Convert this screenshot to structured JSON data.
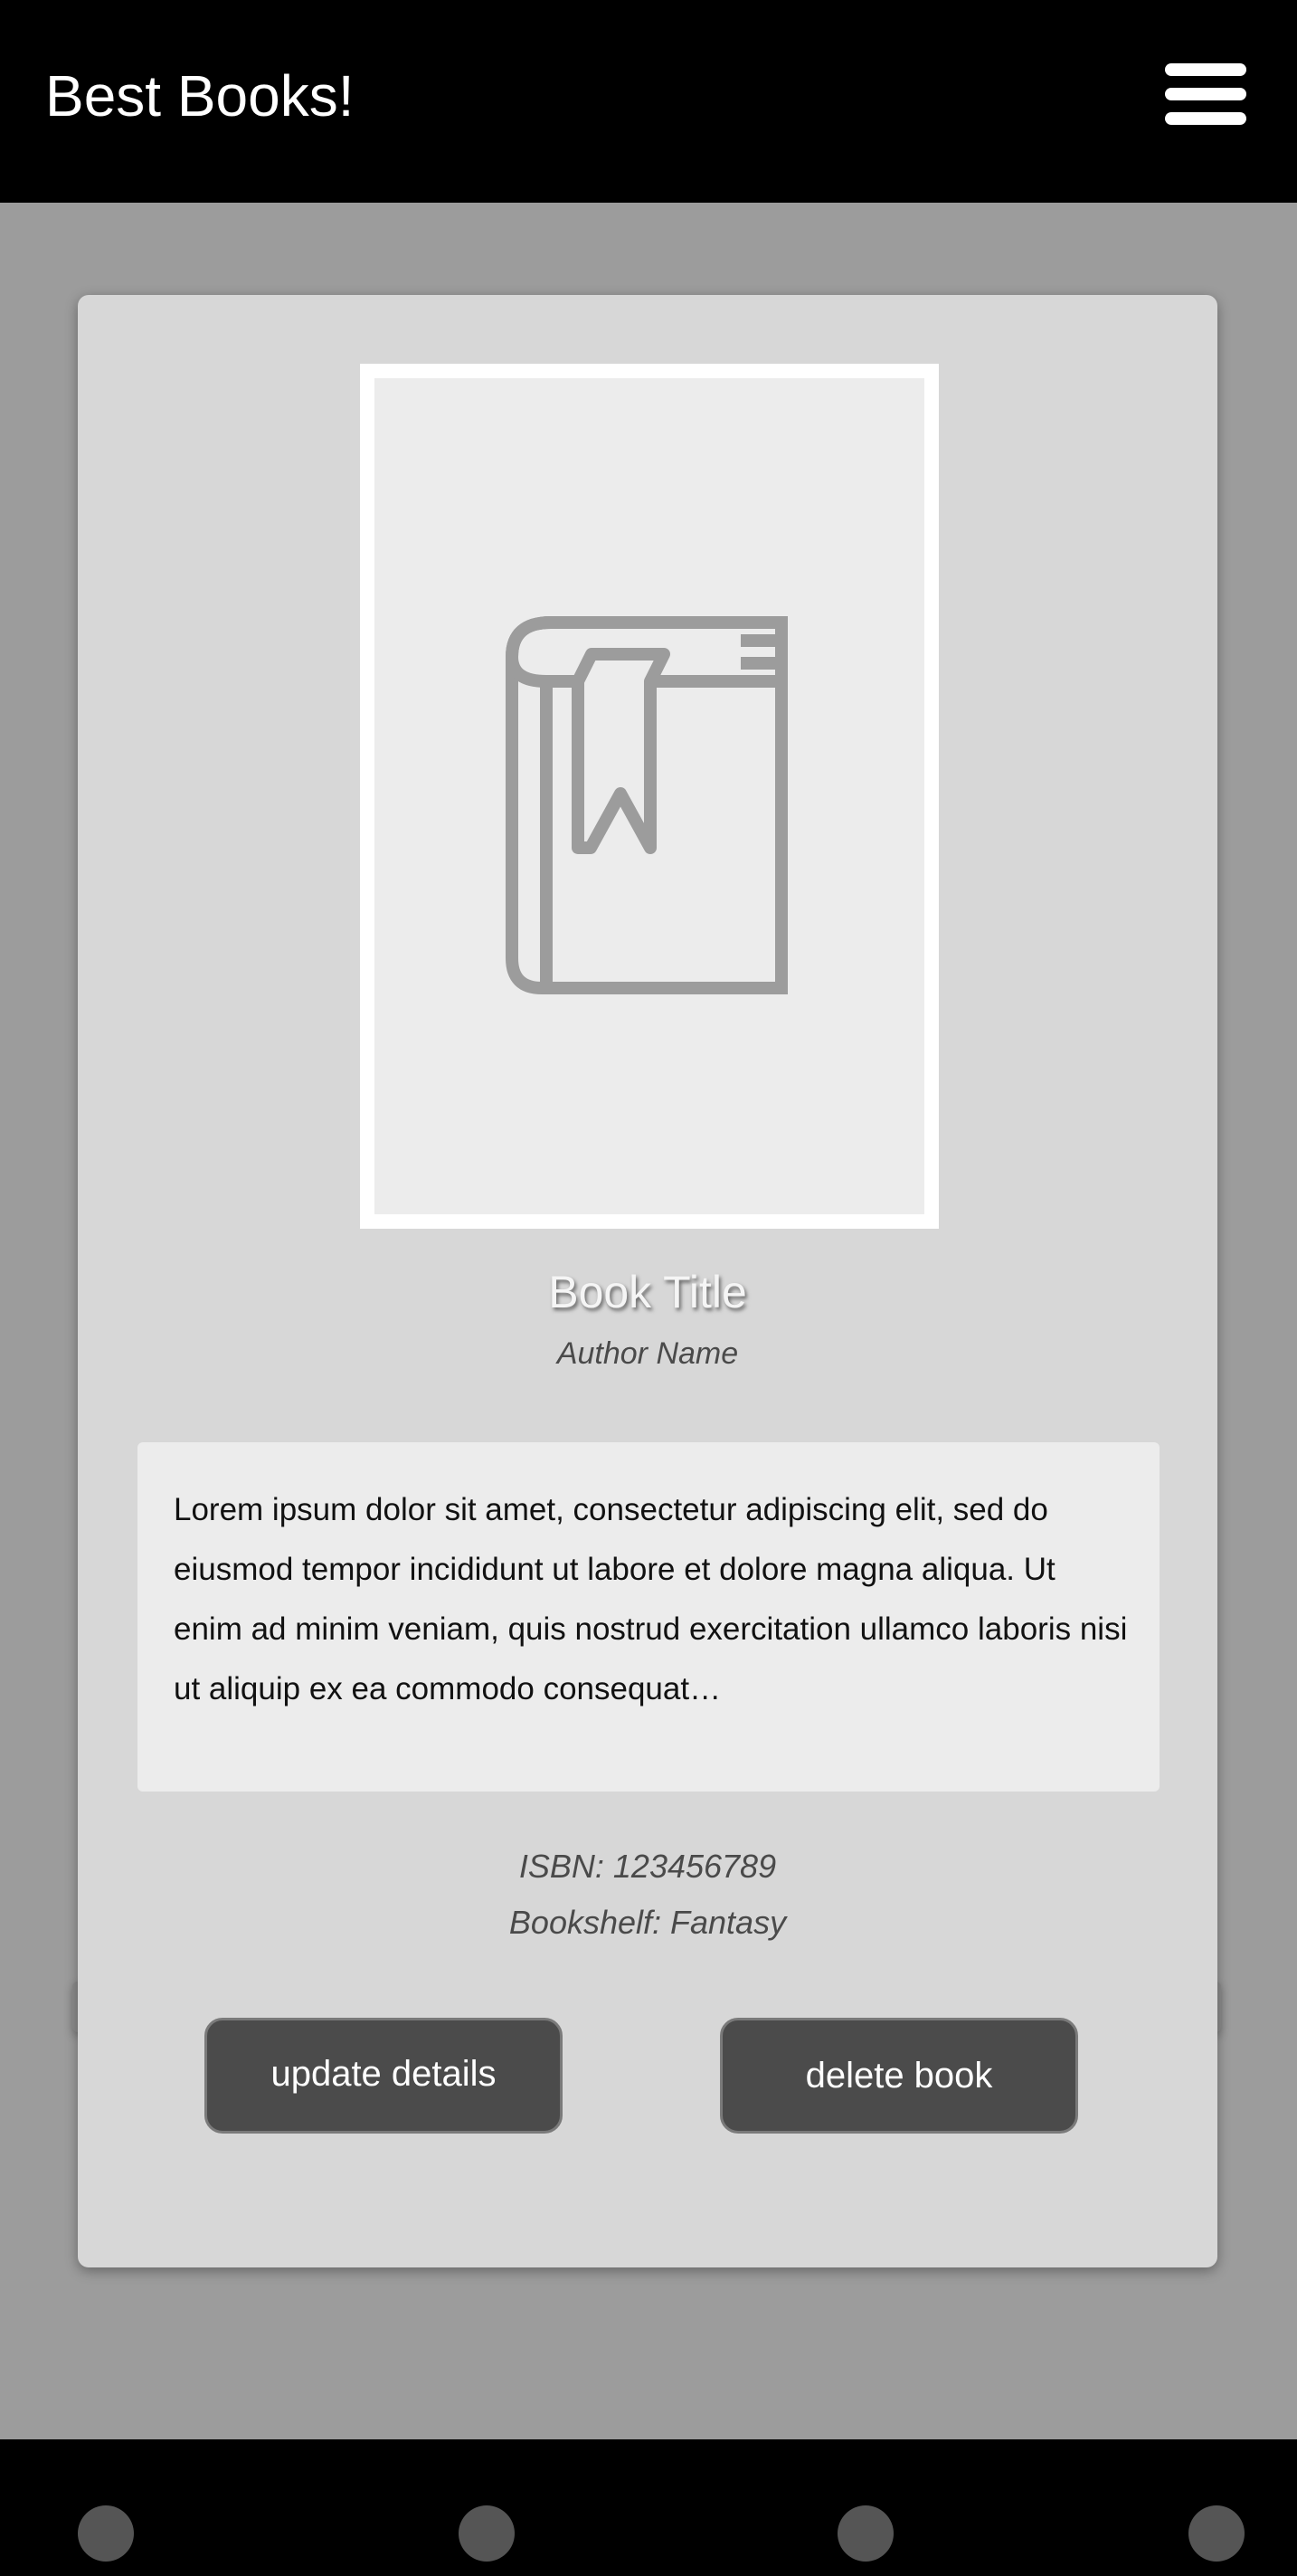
{
  "header": {
    "title": "Best Books!",
    "menu_icon": "hamburger-menu-icon"
  },
  "book": {
    "cover_icon": "book-bookmark-icon",
    "title": "Book Title",
    "author": "Author Name",
    "description": "Lorem ipsum dolor sit amet, consectetur adipiscing elit, sed do eiusmod tempor incididunt ut labore et dolore magna aliqua. Ut enim ad minim veniam, quis nostrud exercitation ullamco laboris nisi ut aliquip ex ea commodo consequat…",
    "isbn": "ISBN: 123456789",
    "bookshelf": "Bookshelf: Fantasy"
  },
  "actions": {
    "update_label": "update details",
    "delete_label": "delete book"
  },
  "bottom_nav": {
    "items": [
      "nav-dot-1",
      "nav-dot-2",
      "nav-dot-3",
      "nav-dot-4"
    ]
  },
  "colors": {
    "bars": "#000000",
    "background": "#9c9c9c",
    "card": "#d7d7d7",
    "button": "#4b4b4b",
    "icon": "#9c9c9c"
  }
}
